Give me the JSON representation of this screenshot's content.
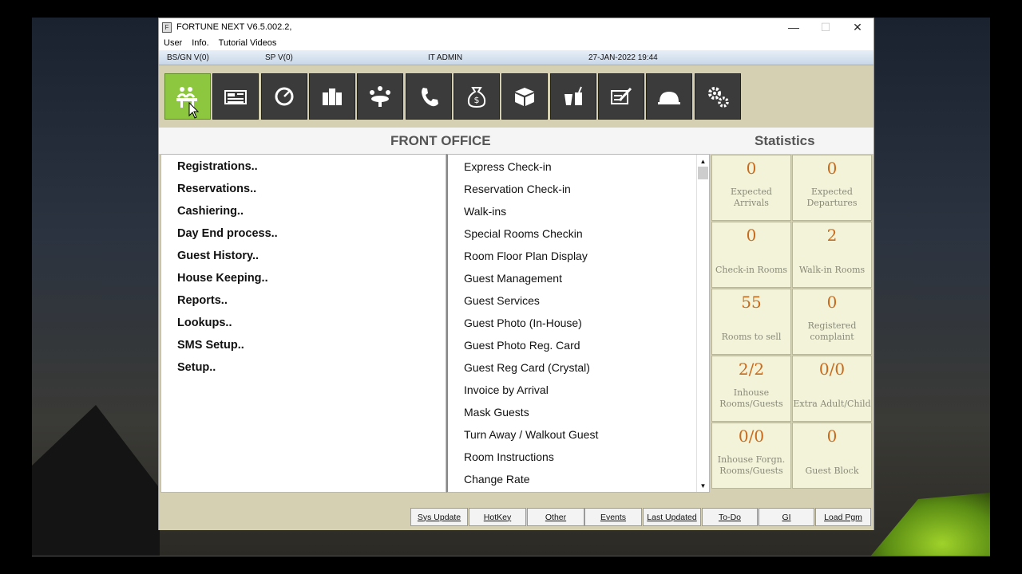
{
  "window": {
    "title": "FORTUNE NEXT  V6.5.002.2,",
    "minimize": "—",
    "maximize": "☐",
    "close": "✕"
  },
  "menu": [
    "User",
    "Info.",
    "Tutorial Videos"
  ],
  "status": {
    "bsgn": "BS/GN V(0)",
    "sp": "SP V(0)",
    "user": "IT ADMIN",
    "datetime": "27-JAN-2022 19:44"
  },
  "toolbar_icons": [
    "front-office-icon",
    "cash-register-icon",
    "speedometer-icon",
    "inventory-icon",
    "banquet-icon",
    "phone-icon",
    "money-bag-icon",
    "package-icon",
    "bar-icon",
    "notes-icon",
    "kitchen-icon",
    "settings-icon"
  ],
  "headers": {
    "front_office": "FRONT OFFICE",
    "statistics": "Statistics"
  },
  "left_menu": [
    "Registrations..",
    "Reservations..",
    "Cashiering..",
    "Day End process..",
    "Guest History..",
    "House Keeping..",
    "Reports..",
    "Lookups..",
    "SMS Setup..",
    "Setup.."
  ],
  "sub_menu": [
    "Express Check-in",
    "Reservation Check-in",
    "Walk-ins",
    "Special Rooms Checkin",
    "Room Floor Plan Display",
    "Guest Management",
    "Guest Services",
    "Guest Photo (In-House)",
    "Guest Photo Reg. Card",
    "Guest Reg Card (Crystal)",
    "Invoice by Arrival",
    "Mask Guests",
    "Turn Away / Walkout Guest",
    "Room Instructions",
    "Change Rate"
  ],
  "stats": [
    {
      "value": "0",
      "label": "Expected Arrivals"
    },
    {
      "value": "0",
      "label": "Expected Departures"
    },
    {
      "value": "0",
      "label": "Check-in Rooms"
    },
    {
      "value": "2",
      "label": "Walk-in Rooms"
    },
    {
      "value": "55",
      "label": "Rooms to sell"
    },
    {
      "value": "0",
      "label": "Registered complaint"
    },
    {
      "value": "2/2",
      "label": "Inhouse Rooms/Guests"
    },
    {
      "value": "0/0",
      "label": "Extra Adult/Child"
    },
    {
      "value": "0/0",
      "label": "Inhouse Forgn. Rooms/Guests"
    },
    {
      "value": "0",
      "label": "Guest Block"
    }
  ],
  "bottom_buttons": [
    "Sys Update",
    "HotKey",
    "Other",
    "Events",
    "Last Updated",
    "To-Do",
    "GI",
    "Load Pgm"
  ],
  "colors": {
    "active_tile": "#8dc63f",
    "tile": "#3b3b3b",
    "stat_value": "#c96a1c",
    "panel_bg": "#d5d0b1"
  }
}
